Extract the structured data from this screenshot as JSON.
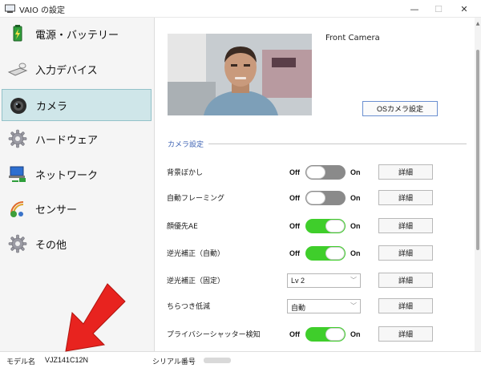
{
  "window": {
    "title": "VAIO の設定",
    "controls": {
      "minimize": "—",
      "maximize": "☐",
      "close": "✕"
    }
  },
  "sidebar": {
    "items": [
      {
        "label": "電源・バッテリー",
        "icon": "battery-icon",
        "active": false
      },
      {
        "label": "入力デバイス",
        "icon": "keyboard-mouse-icon",
        "active": false
      },
      {
        "label": "カメラ",
        "icon": "camera-icon",
        "active": true
      },
      {
        "label": "ハードウェア",
        "icon": "gear-icon",
        "active": false
      },
      {
        "label": "ネットワーク",
        "icon": "network-icon",
        "active": false
      },
      {
        "label": "センサー",
        "icon": "sensor-icon",
        "active": false
      },
      {
        "label": "その他",
        "icon": "gear-icon",
        "active": false
      }
    ]
  },
  "camera": {
    "preview_label": "Front Camera",
    "os_settings_button": "OSカメラ設定"
  },
  "settings": {
    "section_title": "カメラ設定",
    "off_label": "Off",
    "on_label": "On",
    "detail_label": "詳細",
    "rows": [
      {
        "label": "背景ぼかし",
        "control": "toggle",
        "state": "off"
      },
      {
        "label": "自動フレーミング",
        "control": "toggle",
        "state": "off"
      },
      {
        "label": "顔優先AE",
        "control": "toggle",
        "state": "on"
      },
      {
        "label": "逆光補正（自動）",
        "control": "toggle",
        "state": "on"
      },
      {
        "label": "逆光補正（固定）",
        "control": "select",
        "value": "Lv 2"
      },
      {
        "label": "ちらつき低減",
        "control": "select",
        "value": "自動"
      },
      {
        "label": "プライバシーシャッター検知",
        "control": "toggle",
        "state": "on"
      }
    ]
  },
  "status": {
    "model_label": "モデル名",
    "model_value": "VJZ141C12N",
    "serial_label": "シリアル番号"
  },
  "colors": {
    "accent": "#3d62b3",
    "toggle_on": "#3fce2b",
    "toggle_off": "#8a8a8a",
    "active_nav": "#cfe6e9",
    "annotation_arrow": "#e8231f"
  }
}
